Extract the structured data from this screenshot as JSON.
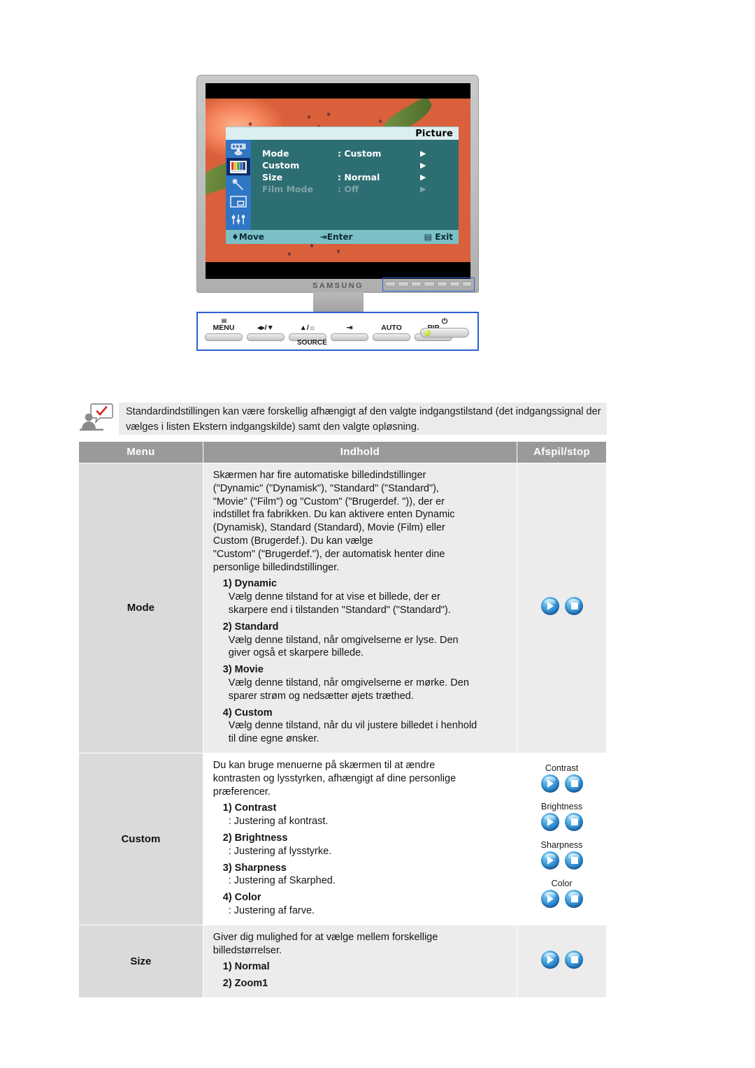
{
  "illustration": {
    "brand": "SAMSUNG",
    "osd": {
      "title": "Picture",
      "rows": [
        {
          "label": "Mode",
          "value": ": Custom",
          "arrow": "▶",
          "dimmed": false
        },
        {
          "label": "Custom",
          "value": "",
          "arrow": "▶",
          "dimmed": false
        },
        {
          "label": "Size",
          "value": ": Normal",
          "arrow": "▶",
          "dimmed": false
        },
        {
          "label": "Film Mode",
          "value": ": Off",
          "arrow": "▶",
          "dimmed": true
        }
      ],
      "footer": {
        "move": "Move",
        "enter": "Enter",
        "exit": "Exit"
      },
      "icons": [
        "tuner-icon",
        "color-bars-icon",
        "magic-wand-icon",
        "pip-icon",
        "sliders-icon"
      ],
      "selected_icon_index": 1
    },
    "controls": {
      "buttons": [
        {
          "name": "menu-button",
          "label": "MENU",
          "icon": "menu-icon"
        },
        {
          "name": "volume-down-button",
          "label": "◂▸/▼",
          "icon": "volume-icon"
        },
        {
          "name": "brightness-up-button",
          "label": "▲/☼",
          "icon": "brightness-icon"
        },
        {
          "name": "source-button",
          "label": "➕",
          "icon": "enter-source-icon"
        },
        {
          "name": "auto-button",
          "label": "AUTO",
          "icon": ""
        },
        {
          "name": "pip-button",
          "label": "PIP",
          "icon": ""
        }
      ],
      "source_label": "SOURCE",
      "power_label": "⏻"
    }
  },
  "note": {
    "icon": "note-person-icon",
    "text": "Standardindstillingen kan være forskellig afhængigt af den valgte indgangstilstand (det indgangssignal der vælges i listen Ekstern indgangskilde) samt den valgte opløsning."
  },
  "table": {
    "headers": [
      "Menu",
      "Indhold",
      "Afspil/stop"
    ],
    "rows": [
      {
        "menu": "Mode",
        "shaded": true,
        "intro": [
          "Skærmen har fire automatiske billedindstillinger",
          "(\"Dynamic\" (\"Dynamisk\"), \"Standard\" (\"Standard\"),",
          "\"Movie\" (\"Film\") og \"Custom\" (\"Brugerdef. \")), der er",
          "indstillet fra fabrikken. Du kan aktivere enten Dynamic",
          "(Dynamisk), Standard (Standard), Movie (Film) eller",
          "Custom (Brugerdef.). Du kan vælge",
          "\"Custom\" (\"Brugerdef.\"), der automatisk henter dine",
          "personlige billedindstillinger."
        ],
        "items": [
          {
            "title": "1) Dynamic",
            "lines": [
              "Vælg denne tilstand for at vise et billede, der er",
              "skarpere end i tilstanden \"Standard\" (\"Standard\")."
            ]
          },
          {
            "title": "2) Standard",
            "lines": [
              "Vælg denne tilstand, når omgivelserne er lyse. Den",
              "giver også et skarpere billede."
            ]
          },
          {
            "title": "3) Movie",
            "lines": [
              "Vælg denne tilstand, når omgivelserne er mørke. Den",
              "sparer strøm og nedsætter øjets træthed."
            ]
          },
          {
            "title": "4) Custom",
            "lines": [
              "Vælg denne tilstand, når du vil justere billedet i henhold",
              "til dine egne ønsker."
            ]
          }
        ],
        "play_groups": [
          {
            "label": "",
            "buttons": [
              "play",
              "stop"
            ]
          }
        ]
      },
      {
        "menu": "Custom",
        "shaded": false,
        "intro": [
          "Du kan bruge menuerne på skærmen til at ændre",
          "kontrasten og lysstyrken, afhængigt af dine personlige",
          "præferencer."
        ],
        "items": [
          {
            "title": "1) Contrast",
            "lines": [
              ": Justering af kontrast."
            ]
          },
          {
            "title": "2) Brightness",
            "lines": [
              ": Justering af lysstyrke."
            ]
          },
          {
            "title": "3) Sharpness",
            "lines": [
              ": Justering af Skarphed."
            ]
          },
          {
            "title": "4) Color",
            "lines": [
              ": Justering af farve."
            ]
          }
        ],
        "play_groups": [
          {
            "label": "Contrast",
            "buttons": [
              "play",
              "stop"
            ]
          },
          {
            "label": "Brightness",
            "buttons": [
              "play",
              "stop"
            ]
          },
          {
            "label": "Sharpness",
            "buttons": [
              "play",
              "stop"
            ]
          },
          {
            "label": "Color",
            "buttons": [
              "play",
              "stop"
            ]
          }
        ]
      },
      {
        "menu": "Size",
        "shaded": true,
        "intro": [
          "Giver dig mulighed for at vælge mellem forskellige",
          "billedstørrelser."
        ],
        "items": [
          {
            "title": "1) Normal",
            "lines": []
          },
          {
            "title": "2) Zoom1",
            "lines": []
          }
        ],
        "play_groups": [
          {
            "label": "",
            "buttons": [
              "play",
              "stop"
            ]
          }
        ]
      }
    ]
  },
  "colors": {
    "osd_panel": "#2d6e73",
    "osd_title_bar": "#dbeef0",
    "osd_footer": "#7cc0c7",
    "osd_icon_rail": "#2f76c4",
    "osd_icon_selected": "#0d2a68",
    "table_header": "#9a9a9a",
    "menu_cell": "#dadada",
    "row_shade": "#ececec",
    "note_bg": "#ebebeb",
    "accent_blue": "#2c5fd0",
    "button_blue": "#1f74c0"
  }
}
